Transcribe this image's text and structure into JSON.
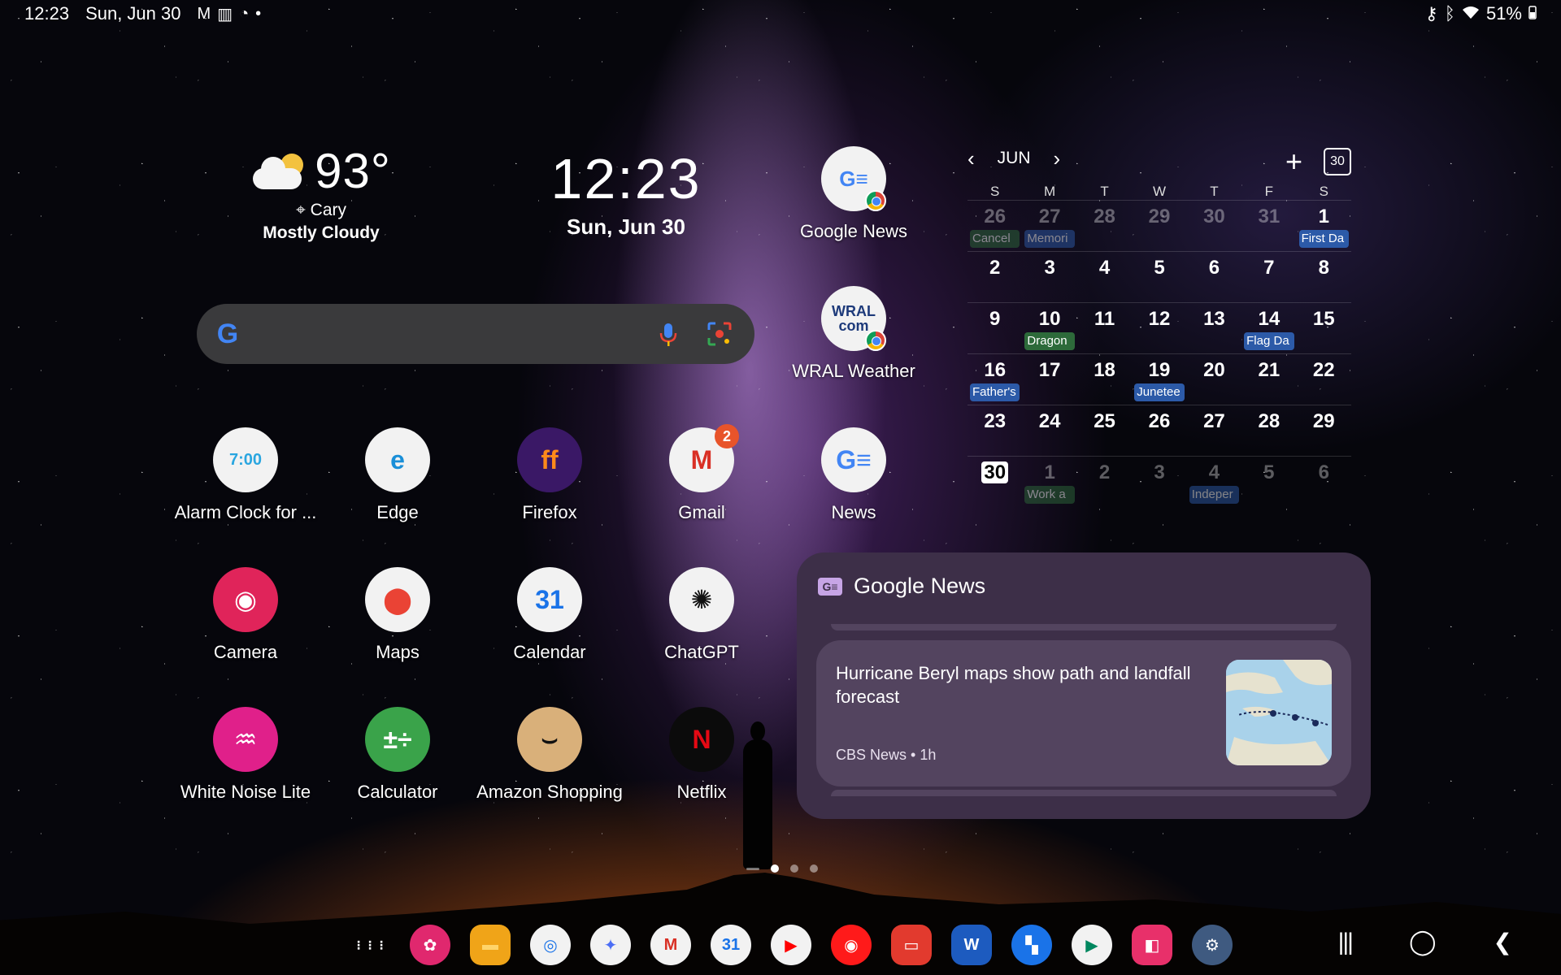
{
  "status_bar": {
    "time": "12:23",
    "date": "Sun, Jun 30",
    "battery": "51%",
    "left_icons": [
      "gmail-icon",
      "work-profile-icon",
      "sync-icon",
      "dot-icon"
    ],
    "right_icons": [
      "vpn-key-icon",
      "bluetooth-icon",
      "wifi-icon",
      "battery-icon"
    ]
  },
  "weather": {
    "temperature": "93°",
    "location": "Cary",
    "condition": "Mostly Cloudy",
    "icon": "partly-cloudy-icon"
  },
  "clock": {
    "time": "12:23",
    "date": "Sun, Jun 30"
  },
  "search": {
    "logo": "G",
    "icons": [
      "google-logo-icon",
      "microphone-icon",
      "google-lens-icon"
    ]
  },
  "side_apps": [
    {
      "label": "Google News",
      "icon": "google-news-icon"
    },
    {
      "label": "WRAL Weather",
      "icon": "wral-weather-icon",
      "icon_text_top": "WRAL",
      "icon_text_bottom": "com"
    }
  ],
  "apps": [
    {
      "label": "Alarm Clock for ...",
      "icon": "alarm-clock-icon",
      "icon_text": "7:00",
      "bg": "#f2f2f2",
      "fg": "#2aa6e0"
    },
    {
      "label": "Edge",
      "icon": "edge-icon",
      "icon_text": "e",
      "bg": "#f2f2f2",
      "fg": "#1a8fd8"
    },
    {
      "label": "Firefox",
      "icon": "firefox-icon",
      "icon_text": "ff",
      "bg": "#3a1866",
      "fg": "#ff8a1a"
    },
    {
      "label": "Gmail",
      "icon": "gmail-icon",
      "icon_text": "M",
      "bg": "#f2f2f2",
      "fg": "#d93025",
      "badge": "2"
    },
    {
      "label": "News",
      "icon": "google-news-icon",
      "icon_text": "G≡",
      "bg": "#f2f2f2",
      "fg": "#4285f4"
    },
    {
      "label": "Camera",
      "icon": "camera-icon",
      "icon_text": "◉",
      "bg": "#e0245a",
      "fg": "#ffffff"
    },
    {
      "label": "Maps",
      "icon": "maps-icon",
      "icon_text": "⬤",
      "bg": "#f2f2f2",
      "fg": "#ea4335"
    },
    {
      "label": "Calendar",
      "icon": "calendar-icon",
      "icon_text": "31",
      "bg": "#f2f2f2",
      "fg": "#1a73e8"
    },
    {
      "label": "ChatGPT",
      "icon": "chatgpt-icon",
      "icon_text": "✺",
      "bg": "#f2f2f2",
      "fg": "#111111"
    },
    {
      "label": "White Noise Lite",
      "icon": "white-noise-icon",
      "icon_text": "♒",
      "bg": "#e0208a",
      "fg": "#ffffff"
    },
    {
      "label": "Calculator",
      "icon": "calculator-icon",
      "icon_text": "±÷",
      "bg": "#3aa34a",
      "fg": "#ffffff"
    },
    {
      "label": "Amazon Shopping",
      "icon": "amazon-shopping-icon",
      "icon_text": "⌣",
      "bg": "#d9b07a",
      "fg": "#111111"
    },
    {
      "label": "Netflix",
      "icon": "netflix-icon",
      "icon_text": "N",
      "bg": "#0b0b0b",
      "fg": "#e50914"
    }
  ],
  "calendar": {
    "month": "JUN",
    "today_button": "30",
    "weekdays": [
      "S",
      "M",
      "T",
      "W",
      "T",
      "F",
      "S"
    ],
    "weeks": [
      {
        "days": [
          {
            "n": "26",
            "dim": true,
            "ev": "Cancel",
            "evc": "green"
          },
          {
            "n": "27",
            "dim": true,
            "ev": "Memori",
            "evc": "blue"
          },
          {
            "n": "28",
            "dim": true
          },
          {
            "n": "29",
            "dim": true
          },
          {
            "n": "30",
            "dim": true
          },
          {
            "n": "31",
            "dim": true
          },
          {
            "n": "1",
            "ev": "First Da",
            "evc": "blue"
          }
        ]
      },
      {
        "days": [
          {
            "n": "2"
          },
          {
            "n": "3"
          },
          {
            "n": "4"
          },
          {
            "n": "5"
          },
          {
            "n": "6"
          },
          {
            "n": "7"
          },
          {
            "n": "8"
          }
        ]
      },
      {
        "days": [
          {
            "n": "9"
          },
          {
            "n": "10",
            "ev": "Dragon",
            "evc": "green"
          },
          {
            "n": "11"
          },
          {
            "n": "12"
          },
          {
            "n": "13"
          },
          {
            "n": "14",
            "ev": "Flag Da",
            "evc": "blue"
          },
          {
            "n": "15"
          }
        ]
      },
      {
        "days": [
          {
            "n": "16",
            "ev": "Father's",
            "evc": "blue"
          },
          {
            "n": "17"
          },
          {
            "n": "18"
          },
          {
            "n": "19",
            "ev": "Junetee",
            "evc": "blue"
          },
          {
            "n": "20"
          },
          {
            "n": "21"
          },
          {
            "n": "22"
          }
        ]
      },
      {
        "days": [
          {
            "n": "23"
          },
          {
            "n": "24"
          },
          {
            "n": "25"
          },
          {
            "n": "26"
          },
          {
            "n": "27"
          },
          {
            "n": "28"
          },
          {
            "n": "29"
          }
        ]
      },
      {
        "days": [
          {
            "n": "30",
            "today": true
          },
          {
            "n": "1",
            "dim": true,
            "ev": "Work a",
            "evc": "green"
          },
          {
            "n": "2",
            "dim": true
          },
          {
            "n": "3",
            "dim": true
          },
          {
            "n": "4",
            "dim": true,
            "ev": "Indeper",
            "evc": "blue"
          },
          {
            "n": "5",
            "dim": true
          },
          {
            "n": "6",
            "dim": true
          }
        ]
      }
    ]
  },
  "news_widget": {
    "title": "Google News",
    "article": {
      "headline": "Hurricane Beryl maps show path and landfall forecast",
      "source": "CBS News",
      "age": "1h"
    }
  },
  "page_indicator": {
    "pages": 3,
    "current": 1
  },
  "dock": [
    {
      "name": "app-drawer-icon",
      "glyph": "⋮⋮⋮",
      "bg": "transparent",
      "fg": "#ffffff"
    },
    {
      "name": "blossom-icon",
      "glyph": "✿",
      "bg": "#e0286e",
      "fg": "#ffffff"
    },
    {
      "name": "my-files-icon",
      "glyph": "▬",
      "bg": "#f0a418",
      "fg": "#ffd46a"
    },
    {
      "name": "chrome-icon",
      "glyph": "◎",
      "bg": "#f2f2f2",
      "fg": "#1a73e8"
    },
    {
      "name": "gemini-icon",
      "glyph": "✦",
      "bg": "#f2f2f2",
      "fg": "#4c6ef5"
    },
    {
      "name": "gmail-icon",
      "glyph": "M",
      "bg": "#f2f2f2",
      "fg": "#d93025"
    },
    {
      "name": "google-calendar-icon",
      "glyph": "31",
      "bg": "#f2f2f2",
      "fg": "#1a73e8"
    },
    {
      "name": "youtube-icon",
      "glyph": "▶",
      "bg": "#f2f2f2",
      "fg": "#ff0000"
    },
    {
      "name": "youtube-music-icon",
      "glyph": "◉",
      "bg": "#ff1a1a",
      "fg": "#ffffff"
    },
    {
      "name": "samsung-notes-icon",
      "glyph": "▭",
      "bg": "#e23a2e",
      "fg": "#ffffff"
    },
    {
      "name": "word-icon",
      "glyph": "W",
      "bg": "#1d5bbf",
      "fg": "#ffffff"
    },
    {
      "name": "remote-desktop-icon",
      "glyph": "▚",
      "bg": "#1a73e8",
      "fg": "#ffffff"
    },
    {
      "name": "play-store-icon",
      "glyph": "▶",
      "bg": "#f2f2f2",
      "fg": "#01875f"
    },
    {
      "name": "galaxy-store-icon",
      "glyph": "◧",
      "bg": "#e8306a",
      "fg": "#ffffff"
    },
    {
      "name": "settings-icon",
      "glyph": "⚙",
      "bg": "#3f5a80",
      "fg": "#ffffff"
    }
  ],
  "nav": {
    "recents": "|||",
    "home": "◯",
    "back": "❮"
  }
}
